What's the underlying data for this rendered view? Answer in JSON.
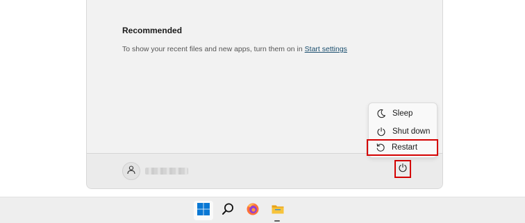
{
  "recommended": {
    "title": "Recommended",
    "message": "To show your recent files and new apps, turn them on in ",
    "link_label": "Start settings"
  },
  "power_menu": {
    "items": [
      {
        "label": "Sleep",
        "icon": "moon-icon"
      },
      {
        "label": "Shut down",
        "icon": "power-icon"
      },
      {
        "label": "Restart",
        "icon": "restart-icon"
      }
    ],
    "highlighted_item": "Restart"
  },
  "footer": {
    "user_icon": "user-icon",
    "power_button_icon": "power-icon"
  },
  "taskbar": {
    "items": [
      {
        "name": "start",
        "icon": "windows-logo-icon"
      },
      {
        "name": "search",
        "icon": "search-icon"
      },
      {
        "name": "firefox",
        "icon": "firefox-icon"
      },
      {
        "name": "file-explorer",
        "icon": "folder-icon"
      }
    ]
  },
  "colors": {
    "highlight": "#d40000",
    "link": "#1a4e6e",
    "windows_blue": "#0a78d4",
    "folder_yellow": "#f7c33b"
  }
}
